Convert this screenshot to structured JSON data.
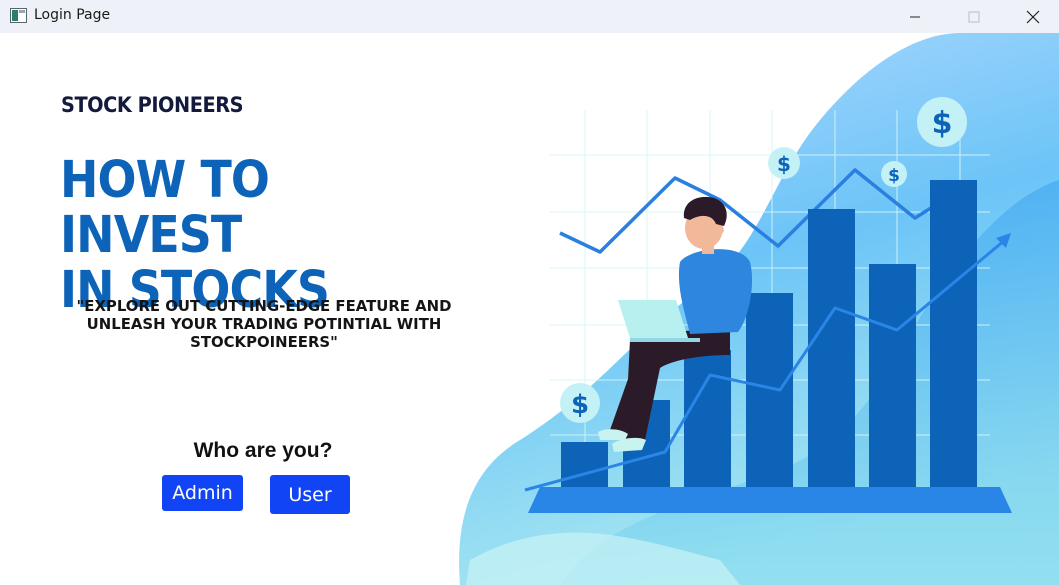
{
  "window": {
    "title": "Login Page"
  },
  "brand": {
    "name": "STOCK PIONEERS"
  },
  "hero": {
    "headline_line1": "HOW TO INVEST",
    "headline_line2": "IN STOCKS",
    "tagline_line1": "\"EXPLORE OUT CUTTING-EDGE FEATURE AND",
    "tagline_line2": "UNLEASH  YOUR TRADING POTINTIAL WITH",
    "tagline_line3": "STOCKPOINEERS\""
  },
  "login": {
    "question": "Who are you?",
    "admin_label": "Admin",
    "user_label": "User"
  },
  "illustration": {
    "coin_symbol": "$"
  },
  "colors": {
    "accent_blue": "#0c63b8",
    "button_blue": "#1144f5",
    "brand_dark": "#141a3d"
  }
}
